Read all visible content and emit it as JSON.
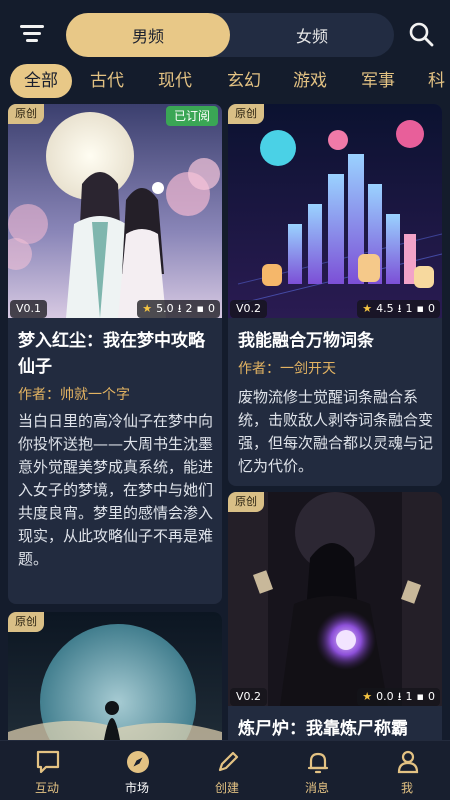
{
  "gender_tabs": [
    "男频",
    "女频"
  ],
  "categories": [
    "全部",
    "古代",
    "现代",
    "玄幻",
    "游戏",
    "军事",
    "科"
  ],
  "cards": [
    {
      "badge": "原创",
      "subscribed": "已订阅",
      "version": "V0.1",
      "rating": "5.0",
      "downloads": "2",
      "comments": "0",
      "title": "梦入红尘：我在梦中攻略仙子",
      "author": "作者：帅就一个字",
      "description": "当白日里的高冷仙子在梦中向你投怀送抱——大周书生沈墨意外觉醒美梦成真系统，能进入女子的梦境，在梦中与她们共度良宵。梦里的感情会渗入现实，从此攻略仙子不再是难题。"
    },
    {
      "badge": "原创",
      "version": "V0.2",
      "rating": "4.5",
      "downloads": "1",
      "comments": "0",
      "title": "我能融合万物词条",
      "author": "作者：一剑开天",
      "description": "废物流修士觉醒词条融合系统，击败敌人剥夺词条融合变强，但每次融合都以灵魂与记忆为代价。"
    },
    {
      "badge": "原创",
      "version": "V0.2",
      "rating": "0.0",
      "downloads": "1",
      "comments": "0",
      "title": "炼尸炉：我靠炼尸称霸"
    },
    {
      "badge": "原创"
    }
  ],
  "nav": [
    "互动",
    "市场",
    "创建",
    "消息",
    "我"
  ],
  "colors": {
    "accent": "#e8c887",
    "background": "#141c2c",
    "card": "#222b3f",
    "subscribed": "#3aa655"
  }
}
